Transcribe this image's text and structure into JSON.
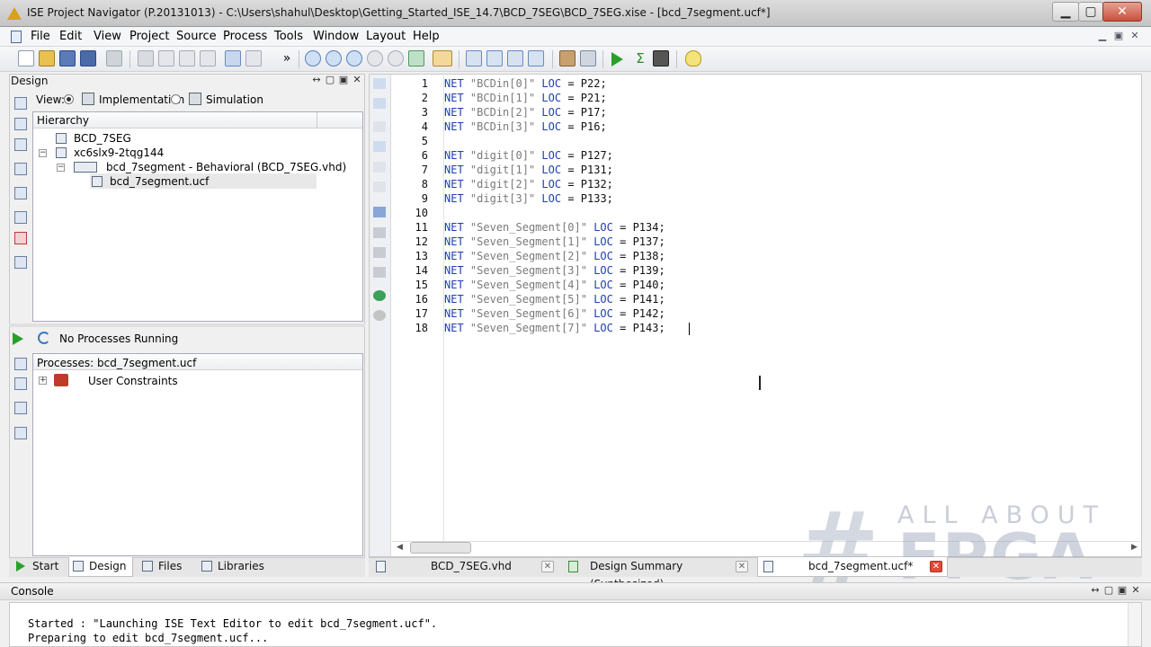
{
  "window": {
    "title": "ISE Project Navigator (P.20131013) - C:\\Users\\shahul\\Desktop\\Getting_Started_ISE_14.7\\BCD_7SEG\\BCD_7SEG.xise - [bcd_7segment.ucf*]",
    "minimize": "▁",
    "maximize": "▢",
    "close": "✕"
  },
  "menu": [
    "File",
    "Edit",
    "View",
    "Project",
    "Source",
    "Process",
    "Tools",
    "Window",
    "Layout",
    "Help"
  ],
  "toolbar": {
    "overflow": "»",
    "icons": [
      "new-file-icon",
      "open-folder-icon",
      "save-icon",
      "save-all-icon",
      "print-icon",
      "cut-icon",
      "copy-icon",
      "paste-icon",
      "delete-icon",
      "undo-icon",
      "redo-icon",
      "zoom-in-icon",
      "zoom-out-icon",
      "zoom-full-icon",
      "zoom-fit-icon",
      "zoom-region-icon",
      "refresh-icon",
      "pen-icon",
      "cascade-icon",
      "tile-horizontal-icon",
      "tile-vertical-icon",
      "restore-icon",
      "wrench-icon",
      "help-icon",
      "run-icon",
      "sum-icon",
      "telescope-icon",
      "lightbulb-icon"
    ]
  },
  "design_panel": {
    "title": "Design",
    "view_label": "View:",
    "view_options": [
      "Implementation",
      "Simulation"
    ],
    "selected_view": "Implementation",
    "hierarchy_header": "Hierarchy",
    "tree": [
      {
        "label": "BCD_7SEG"
      },
      {
        "label": "xc6slx9-2tqg144"
      },
      {
        "label": "bcd_7segment - Behavioral (BCD_7SEG.vhd)"
      },
      {
        "label": "bcd_7segment.ucf"
      }
    ],
    "process_status": "No Processes Running",
    "processes_title": "Processes: bcd_7segment.ucf",
    "process_items": [
      "User Constraints"
    ],
    "tabs": [
      "Start",
      "Design",
      "Files",
      "Libraries"
    ],
    "active_tab": "Design"
  },
  "editor": {
    "lines": [
      {
        "n": "1",
        "kw1": "NET",
        "str": "\"BCDin[0]\"",
        "kw2": "LOC",
        "rest": "= P22;"
      },
      {
        "n": "2",
        "kw1": "NET",
        "str": "\"BCDin[1]\"",
        "kw2": "LOC",
        "rest": "= P21;"
      },
      {
        "n": "3",
        "kw1": "NET",
        "str": "\"BCDin[2]\"",
        "kw2": "LOC",
        "rest": "= P17;"
      },
      {
        "n": "4",
        "kw1": "NET",
        "str": "\"BCDin[3]\"",
        "kw2": "LOC",
        "rest": "= P16;"
      },
      {
        "n": "5",
        "kw1": "",
        "str": "",
        "kw2": "",
        "rest": ""
      },
      {
        "n": "6",
        "kw1": "NET",
        "str": "\"digit[0]\"",
        "kw2": "LOC",
        "rest": "= P127;"
      },
      {
        "n": "7",
        "kw1": "NET",
        "str": "\"digit[1]\"",
        "kw2": "LOC",
        "rest": "= P131;"
      },
      {
        "n": "8",
        "kw1": "NET",
        "str": "\"digit[2]\"",
        "kw2": "LOC",
        "rest": "= P132;"
      },
      {
        "n": "9",
        "kw1": "NET",
        "str": "\"digit[3]\"",
        "kw2": "LOC",
        "rest": "= P133;"
      },
      {
        "n": "10",
        "kw1": "",
        "str": "",
        "kw2": "",
        "rest": ""
      },
      {
        "n": "11",
        "kw1": "NET",
        "str": "\"Seven_Segment[0]\"",
        "kw2": "LOC",
        "rest": "= P134;"
      },
      {
        "n": "12",
        "kw1": "NET",
        "str": "\"Seven_Segment[1]\"",
        "kw2": "LOC",
        "rest": "= P137;"
      },
      {
        "n": "13",
        "kw1": "NET",
        "str": "\"Seven_Segment[2]\"",
        "kw2": "LOC",
        "rest": "= P138;"
      },
      {
        "n": "14",
        "kw1": "NET",
        "str": "\"Seven_Segment[3]\"",
        "kw2": "LOC",
        "rest": "= P139;"
      },
      {
        "n": "15",
        "kw1": "NET",
        "str": "\"Seven_Segment[4]\"",
        "kw2": "LOC",
        "rest": "= P140;"
      },
      {
        "n": "16",
        "kw1": "NET",
        "str": "\"Seven_Segment[5]\"",
        "kw2": "LOC",
        "rest": "= P141;"
      },
      {
        "n": "17",
        "kw1": "NET",
        "str": "\"Seven_Segment[6]\"",
        "kw2": "LOC",
        "rest": "= P142;"
      },
      {
        "n": "18",
        "kw1": "NET",
        "str": "\"Seven_Segment[7]\"",
        "kw2": "LOC",
        "rest": "= P143;"
      }
    ],
    "tabs": [
      {
        "label": "BCD_7SEG.vhd"
      },
      {
        "label": "Design Summary (Synthesized)"
      },
      {
        "label": "bcd_7segment.ucf*"
      }
    ],
    "active_tab": "bcd_7segment.ucf*"
  },
  "console": {
    "title": "Console",
    "lines": [
      "Started : \"Launching ISE Text Editor to edit bcd_7segment.ucf\".",
      "Preparing to edit bcd_7segment.ucf..."
    ]
  },
  "watermark": {
    "hash": "#",
    "top": "ALL ABOUT",
    "big": "FPGA"
  },
  "colors": {
    "keyword": "#1f3fae",
    "string": "#7a7a7a",
    "run_green": "#2aa02a",
    "close_red": "#e04a3a"
  }
}
